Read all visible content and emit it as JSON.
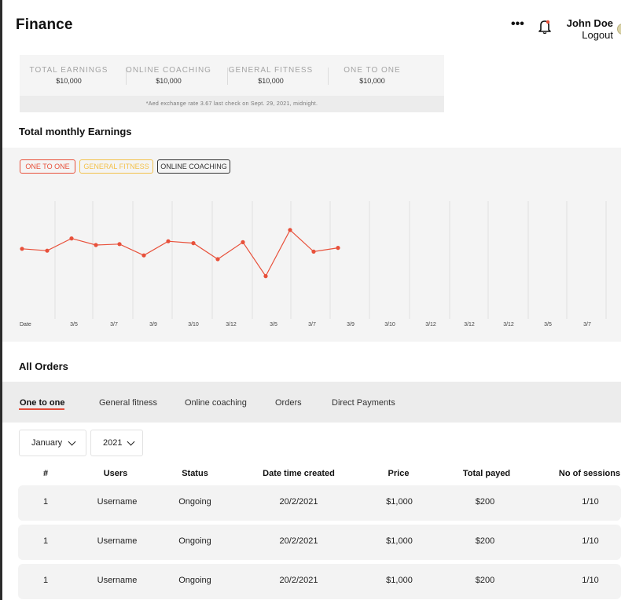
{
  "header": {
    "title": "Finance",
    "more_icon": "more-horizontal-icon",
    "bell_icon": "bell-icon",
    "user_name": "John Doe",
    "logout_label": "Logout"
  },
  "summary": {
    "items": [
      {
        "label": "TOTAL EARNINGS",
        "value": "$10,000"
      },
      {
        "label": "ONLINE COACHING",
        "value": "$10,000"
      },
      {
        "label": "GENERAL FITNESS",
        "value": "$10,000"
      },
      {
        "label": "ONE TO ONE",
        "value": "$10,000"
      }
    ],
    "note": "*Aed exchange rate 3.67 last check on Sept. 29, 2021, midnight."
  },
  "chart_section_title": "Total monthly Earnings",
  "legend": [
    {
      "label": "ONE TO ONE",
      "color": "#e8503a"
    },
    {
      "label": "GENERAL FITNESS",
      "color": "#f3c14a"
    },
    {
      "label": "ONLINE COACHING",
      "color": "#333333"
    }
  ],
  "chart_data": {
    "type": "line",
    "xlabel": "Date",
    "categories": [
      "3/5",
      "3/7",
      "3/9",
      "3/10",
      "3/12",
      "3/5",
      "3/7",
      "3/9",
      "3/10",
      "3/12",
      "3/12",
      "3/12",
      "3/5",
      "3/7"
    ],
    "series": [
      {
        "name": "ONE TO ONE",
        "color": "#e8503a",
        "values": [
          0.51,
          0.49,
          0.62,
          0.55,
          0.56,
          0.44,
          0.59,
          0.57,
          0.4,
          0.58,
          0.22,
          0.71,
          0.48,
          0.52
        ]
      }
    ],
    "ylim": [
      0,
      1
    ],
    "grid": "vertical"
  },
  "orders": {
    "title": "All Orders",
    "tabs": [
      "One to one",
      "General fitness",
      "Online coaching",
      "Orders",
      "Direct Payments"
    ],
    "active_tab": "One to one",
    "month_select": "January",
    "year_select": "2021",
    "columns": [
      "#",
      "Users",
      "Status",
      "Date time created",
      "Price",
      "Total payed",
      "No of sessions"
    ],
    "rows": [
      [
        "1",
        "Username",
        "Ongoing",
        "20/2/2021",
        "$1,000",
        "$200",
        "1/10"
      ],
      [
        "1",
        "Username",
        "Ongoing",
        "20/2/2021",
        "$1,000",
        "$200",
        "1/10"
      ],
      [
        "1",
        "Username",
        "Ongoing",
        "20/2/2021",
        "$1,000",
        "$200",
        "1/10"
      ]
    ]
  }
}
